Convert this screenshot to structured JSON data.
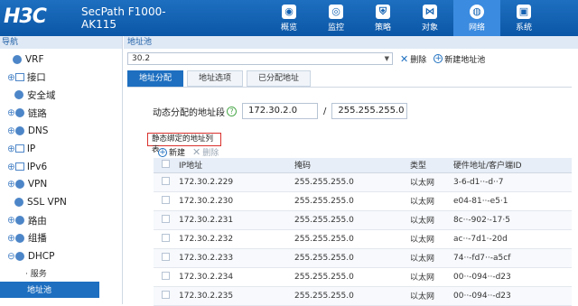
{
  "header": {
    "logo": "H3C",
    "model": "SecPath F1000-AK115",
    "nav": [
      {
        "label": "概览",
        "icon": "dashboard-icon",
        "glyph": "◉"
      },
      {
        "label": "监控",
        "icon": "monitor-icon",
        "glyph": "◎"
      },
      {
        "label": "策略",
        "icon": "shield-icon",
        "glyph": "⛨"
      },
      {
        "label": "对象",
        "icon": "share-icon",
        "glyph": "⋈"
      },
      {
        "label": "网络",
        "icon": "globe-icon",
        "glyph": "◍",
        "active": true
      },
      {
        "label": "系统",
        "icon": "system-icon",
        "glyph": "▣"
      }
    ]
  },
  "sidebar": {
    "title": "导航",
    "items": [
      {
        "label": "VRF",
        "prefix": ""
      },
      {
        "label": "接口",
        "prefix": "⊕"
      },
      {
        "label": "安全域",
        "prefix": ""
      },
      {
        "label": "链路",
        "prefix": "⊕"
      },
      {
        "label": "DNS",
        "prefix": "⊕"
      },
      {
        "label": "IP",
        "prefix": "⊕"
      },
      {
        "label": "IPv6",
        "prefix": "⊕"
      },
      {
        "label": "VPN",
        "prefix": "⊕"
      },
      {
        "label": "SSL VPN",
        "prefix": ""
      },
      {
        "label": "路由",
        "prefix": "⊕"
      },
      {
        "label": "组播",
        "prefix": "⊕"
      },
      {
        "label": "DHCP",
        "prefix": "⊖"
      }
    ],
    "sub_service": "· 服务",
    "active_item": "地址池"
  },
  "main": {
    "breadcrumb": "地址池",
    "pool_select": "30.2",
    "delete_label": "删除",
    "new_pool_label": "新建地址池",
    "tabs": [
      "地址分配",
      "地址选项",
      "已分配地址"
    ],
    "range_label": "动态分配的地址段",
    "range_start": "172.30.2.0",
    "range_mask": "255.255.255.0",
    "static_list_label": "静态绑定的地址列表",
    "new_label": "新建",
    "del_label": "删除",
    "columns": [
      "IP地址",
      "掩码",
      "类型",
      "硬件地址/客户端ID"
    ],
    "rows": [
      {
        "ip": "172.30.2.229",
        "mask": "255.255.255.0",
        "type": "以太网",
        "hw": "3-6-d1··-d··7"
      },
      {
        "ip": "172.30.2.230",
        "mask": "255.255.255.0",
        "type": "以太网",
        "hw": "e04-81··-e5·1"
      },
      {
        "ip": "172.30.2.231",
        "mask": "255.255.255.0",
        "type": "以太网",
        "hw": "8c··-902·-17·5"
      },
      {
        "ip": "172.30.2.232",
        "mask": "255.255.255.0",
        "type": "以太网",
        "hw": "ac··-7d1·-20d"
      },
      {
        "ip": "172.30.2.233",
        "mask": "255.255.255.0",
        "type": "以太网",
        "hw": "74··-fd7··-a5cf"
      },
      {
        "ip": "172.30.2.234",
        "mask": "255.255.255.0",
        "type": "以太网",
        "hw": "00··-094··-d23"
      },
      {
        "ip": "172.30.2.235",
        "mask": "255.255.255.0",
        "type": "以太网",
        "hw": "00··-094··-d23"
      }
    ]
  }
}
